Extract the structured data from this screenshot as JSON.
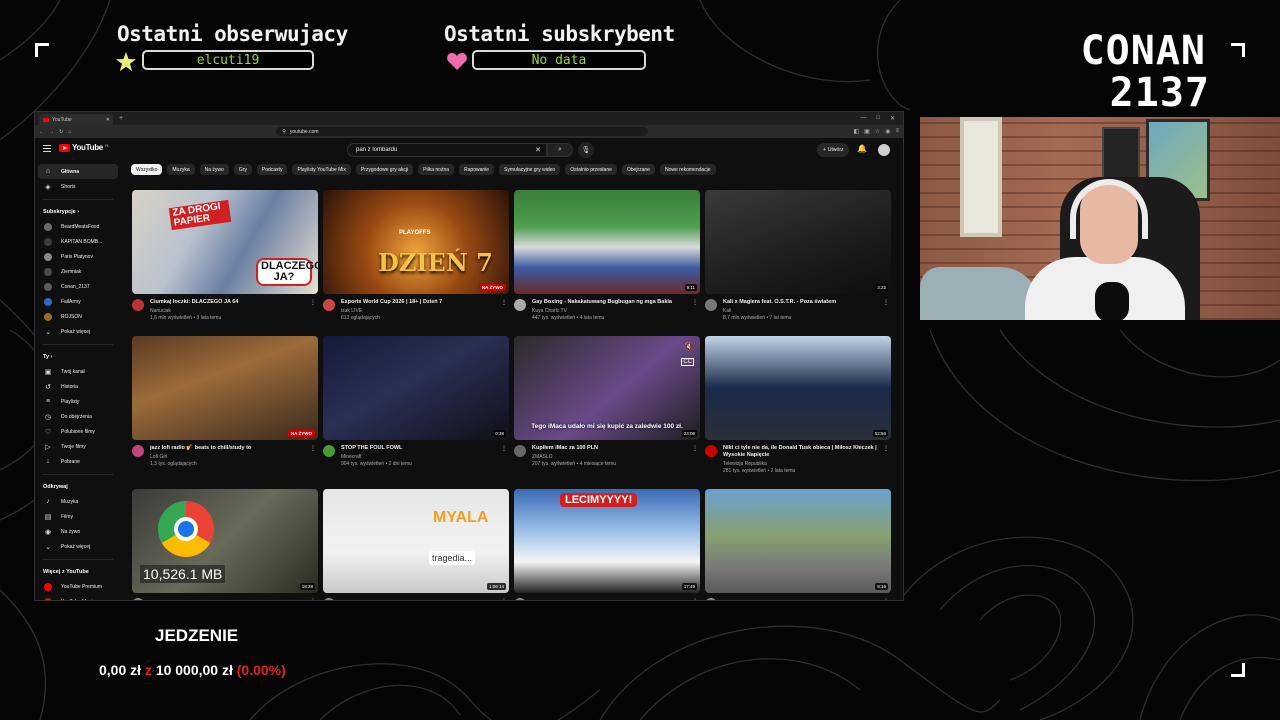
{
  "overlay": {
    "followers_label": "Ostatni obserwujacy",
    "follower_name": "elcuti19",
    "subscriber_label": "Ostatni subskrybent",
    "subscriber_name": "No data",
    "streamer_line1": "CONAN",
    "streamer_line2": "2137",
    "goal_title": "JEDZENIE",
    "goal_current": "0,00 zł",
    "goal_sep": "z",
    "goal_target": "10 000,00 zł",
    "goal_percent": "(0.00%)"
  },
  "browser": {
    "tab_title": "YouTube",
    "new_tab": "+",
    "url": "youtube.com"
  },
  "youtube": {
    "logo": "YouTube",
    "logo_region": "PL",
    "search_query": "pan z lombardu",
    "search_clear": "✕",
    "create_label": "Utwórz",
    "sidebar": {
      "main": [
        {
          "label": "Główna",
          "icon": "home-icon",
          "glyph": "⌂"
        },
        {
          "label": "Shorts",
          "icon": "shorts-icon",
          "glyph": "◈"
        }
      ],
      "subs_header": "Subskrypcje  ›",
      "subs": [
        {
          "label": "BeardMeatsFood",
          "color": "#6a6a6a"
        },
        {
          "label": "KAPITAN BOMB...",
          "color": "#3b3b3b"
        },
        {
          "label": "Paris Platynov",
          "color": "#8a8a8a"
        },
        {
          "label": "Ziemniak",
          "color": "#4a4a4a"
        },
        {
          "label": "Conan_2137",
          "color": "#5c5c5c"
        },
        {
          "label": "FailArmy",
          "color": "#2a6ac9"
        },
        {
          "label": "ROJSON",
          "color": "#9a6b2a"
        }
      ],
      "subs_more": "Pokaż więcej",
      "you_header": "Ty  ›",
      "you": [
        {
          "label": "Twój kanał",
          "icon": "channel-icon",
          "glyph": "▣"
        },
        {
          "label": "Historia",
          "icon": "history-icon",
          "glyph": "↺"
        },
        {
          "label": "Playlisty",
          "icon": "playlist-icon",
          "glyph": "≡"
        },
        {
          "label": "Do obejrzenia",
          "icon": "watch-later-icon",
          "glyph": "◷"
        },
        {
          "label": "Polubione filmy",
          "icon": "like-icon",
          "glyph": "♡"
        },
        {
          "label": "Twoje filmy",
          "icon": "video-icon",
          "glyph": "▷"
        },
        {
          "label": "Pobrane",
          "icon": "download-icon",
          "glyph": "↓"
        }
      ],
      "explore_header": "Odkrywaj",
      "explore": [
        {
          "label": "Muzyka",
          "icon": "music-icon",
          "glyph": "♪"
        },
        {
          "label": "Filmy",
          "icon": "film-icon",
          "glyph": "▤"
        },
        {
          "label": "Na żywo",
          "icon": "live-icon",
          "glyph": "◉"
        }
      ],
      "explore_more": "Pokaż więcej",
      "more_header": "Więcej z YouTube",
      "more": [
        {
          "label": "YouTube Premium",
          "color": "#ff0000"
        },
        {
          "label": "YouTube Music",
          "color": "#ff0000"
        }
      ]
    },
    "chips": [
      "Wszystko",
      "Muzyka",
      "Na żywo",
      "Gry",
      "Podcasty",
      "Playlisty YouTube Mix",
      "Przygodowe gry akcji",
      "Piłka nożna",
      "Rapowanie",
      "Symulacyjne gry wideo",
      "Ostatnio przesłane",
      "Obejrzane",
      "Nowe rekomendacje"
    ],
    "videos": [
      {
        "title": "Ciumkaj łoczki: DLACZEGO JA 64",
        "channel": "Nanuciak",
        "stats": "1,6 mln wyświetleń • 3 lata temu",
        "badge": "",
        "thumb_text": "ZA DROGI PAPIER",
        "thumb_text2": "DLACZEGO JA?",
        "avatar": "#b33"
      },
      {
        "title": "Esports World Cup 2026 | 18+ | Dzień 7",
        "channel": "izak LIVE",
        "stats": "613 oglądających",
        "badge": "NA ŻYWO",
        "thumb_text": "DZIEŃ 7",
        "thumb_text2": "PLAYOFFS",
        "avatar": "#c44"
      },
      {
        "title": "Gay Boxing - Nakakatuwang Bugbugan ng mga Bakla",
        "channel": "Kuya Charlz TV",
        "stats": "447 tys. wyświetleń • 4 lata temu",
        "badge": "9:11",
        "thumb_text": "",
        "thumb_text2": "",
        "avatar": "#aaa"
      },
      {
        "title": "Kali x Magiera feat. O.S.T.R. - Poza światem",
        "channel": "Kali",
        "stats": "8,7 mln wyświetleń • 7 lat temu",
        "badge": "3:22",
        "thumb_text": "",
        "thumb_text2": "",
        "avatar": "#777"
      },
      {
        "title": "jazz lofi radio 🎷 beats to chill/study to",
        "channel": "Lofi Girl",
        "stats": "1,3 tys. oglądających",
        "badge": "NA ŻYWO",
        "thumb_text": "",
        "thumb_text2": "",
        "avatar": "#c2447a"
      },
      {
        "title": "STOP THE FOUL FOWL",
        "channel": "Minecraft",
        "stats": "904 tys. wyświetleń • 2 dni temu",
        "badge": "0:38",
        "thumb_text": "",
        "thumb_text2": "",
        "avatar": "#4a9a3a"
      },
      {
        "title": "Kupiłem iMac za 100 PLN",
        "channel": "ZMASLO",
        "stats": "207 tys. wyświetleń • 4 miesiące temu",
        "badge": "23:08",
        "thumb_text": "Tego iMaca udało mi się kupić za zaledwie 100 zł.",
        "thumb_text2": "",
        "avatar": "#666"
      },
      {
        "title": "Nikt ci tyle nie da, ile Donald Tusk obieca | Miłosz Kłeczek | Wysokie Napięcie",
        "channel": "Telewizja Republika",
        "stats": "281 tys. wyświetleń • 2 lata temu",
        "badge": "52:56",
        "thumb_text": "",
        "thumb_text2": "",
        "avatar": "#c00"
      },
      {
        "title": "",
        "channel": "",
        "stats": "",
        "badge": "18:28",
        "thumb_text": "10,526.1 MB",
        "thumb_text2": "",
        "avatar": "#888"
      },
      {
        "title": "",
        "channel": "",
        "stats": "",
        "badge": "1:06:14",
        "thumb_text": "MYALA",
        "thumb_text2": "tragedia...",
        "avatar": "#888"
      },
      {
        "title": "",
        "channel": "",
        "stats": "",
        "badge": "17:49",
        "thumb_text": "LECIMYYYY!",
        "thumb_text2": "",
        "avatar": "#888"
      },
      {
        "title": "",
        "channel": "",
        "stats": "",
        "badge": "9:16",
        "thumb_text": "",
        "thumb_text2": "",
        "avatar": "#888"
      }
    ]
  }
}
